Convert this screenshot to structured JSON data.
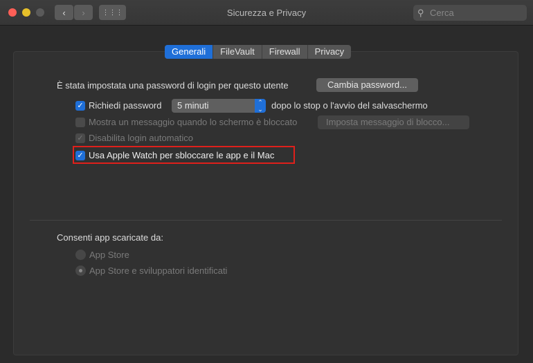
{
  "window": {
    "title": "Sicurezza e Privacy",
    "search_placeholder": "Cerca"
  },
  "tabs": [
    {
      "label": "Generali",
      "active": true
    },
    {
      "label": "FileVault"
    },
    {
      "label": "Firewall"
    },
    {
      "label": "Privacy"
    }
  ],
  "general": {
    "password_text": "È stata impostata una password di login per questo utente",
    "change_password": "Cambia password...",
    "require_password": {
      "label": "Richiedi password",
      "checked": true,
      "value": "5 minuti",
      "suffix": "dopo lo stop o l'avvio del salvaschermo"
    },
    "show_message": {
      "label": "Mostra un messaggio quando lo schermo è bloccato",
      "checked": false,
      "disabled": true,
      "button": "Imposta messaggio di blocco..."
    },
    "disable_auto_login": {
      "label": "Disabilita login automatico",
      "checked": true,
      "disabled": true
    },
    "apple_watch": {
      "label": "Usa Apple Watch per sbloccare le app e il Mac",
      "checked": true,
      "highlighted": true
    },
    "allow_apps_label": "Consenti app scaricate da:",
    "allow_options": [
      {
        "label": "App Store",
        "selected": false
      },
      {
        "label": "App Store e sviluppatori identificati",
        "selected": true
      }
    ]
  },
  "colors": {
    "accent": "#1f6fd8",
    "highlight": "#e0201b"
  }
}
